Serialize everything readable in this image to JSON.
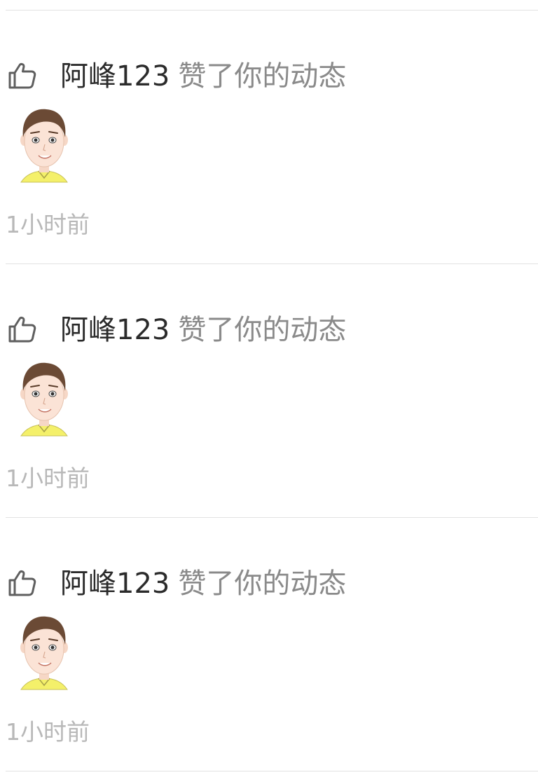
{
  "notifications": [
    {
      "user": "阿峰123",
      "action": "赞了你的动态",
      "time": "1小时前",
      "icon": "thumbs-up-icon"
    },
    {
      "user": "阿峰123",
      "action": "赞了你的动态",
      "time": "1小时前",
      "icon": "thumbs-up-icon"
    },
    {
      "user": "阿峰123",
      "action": "赞了你的动态",
      "time": "1小时前",
      "icon": "thumbs-up-icon"
    }
  ],
  "colors": {
    "user_name": "#2b2b2b",
    "action_text": "#8a8a8a",
    "time_text": "#b8b8b8",
    "divider": "#e2e2e2",
    "avatar_shirt": "#f4f06a",
    "avatar_hair": "#6b4a35"
  }
}
